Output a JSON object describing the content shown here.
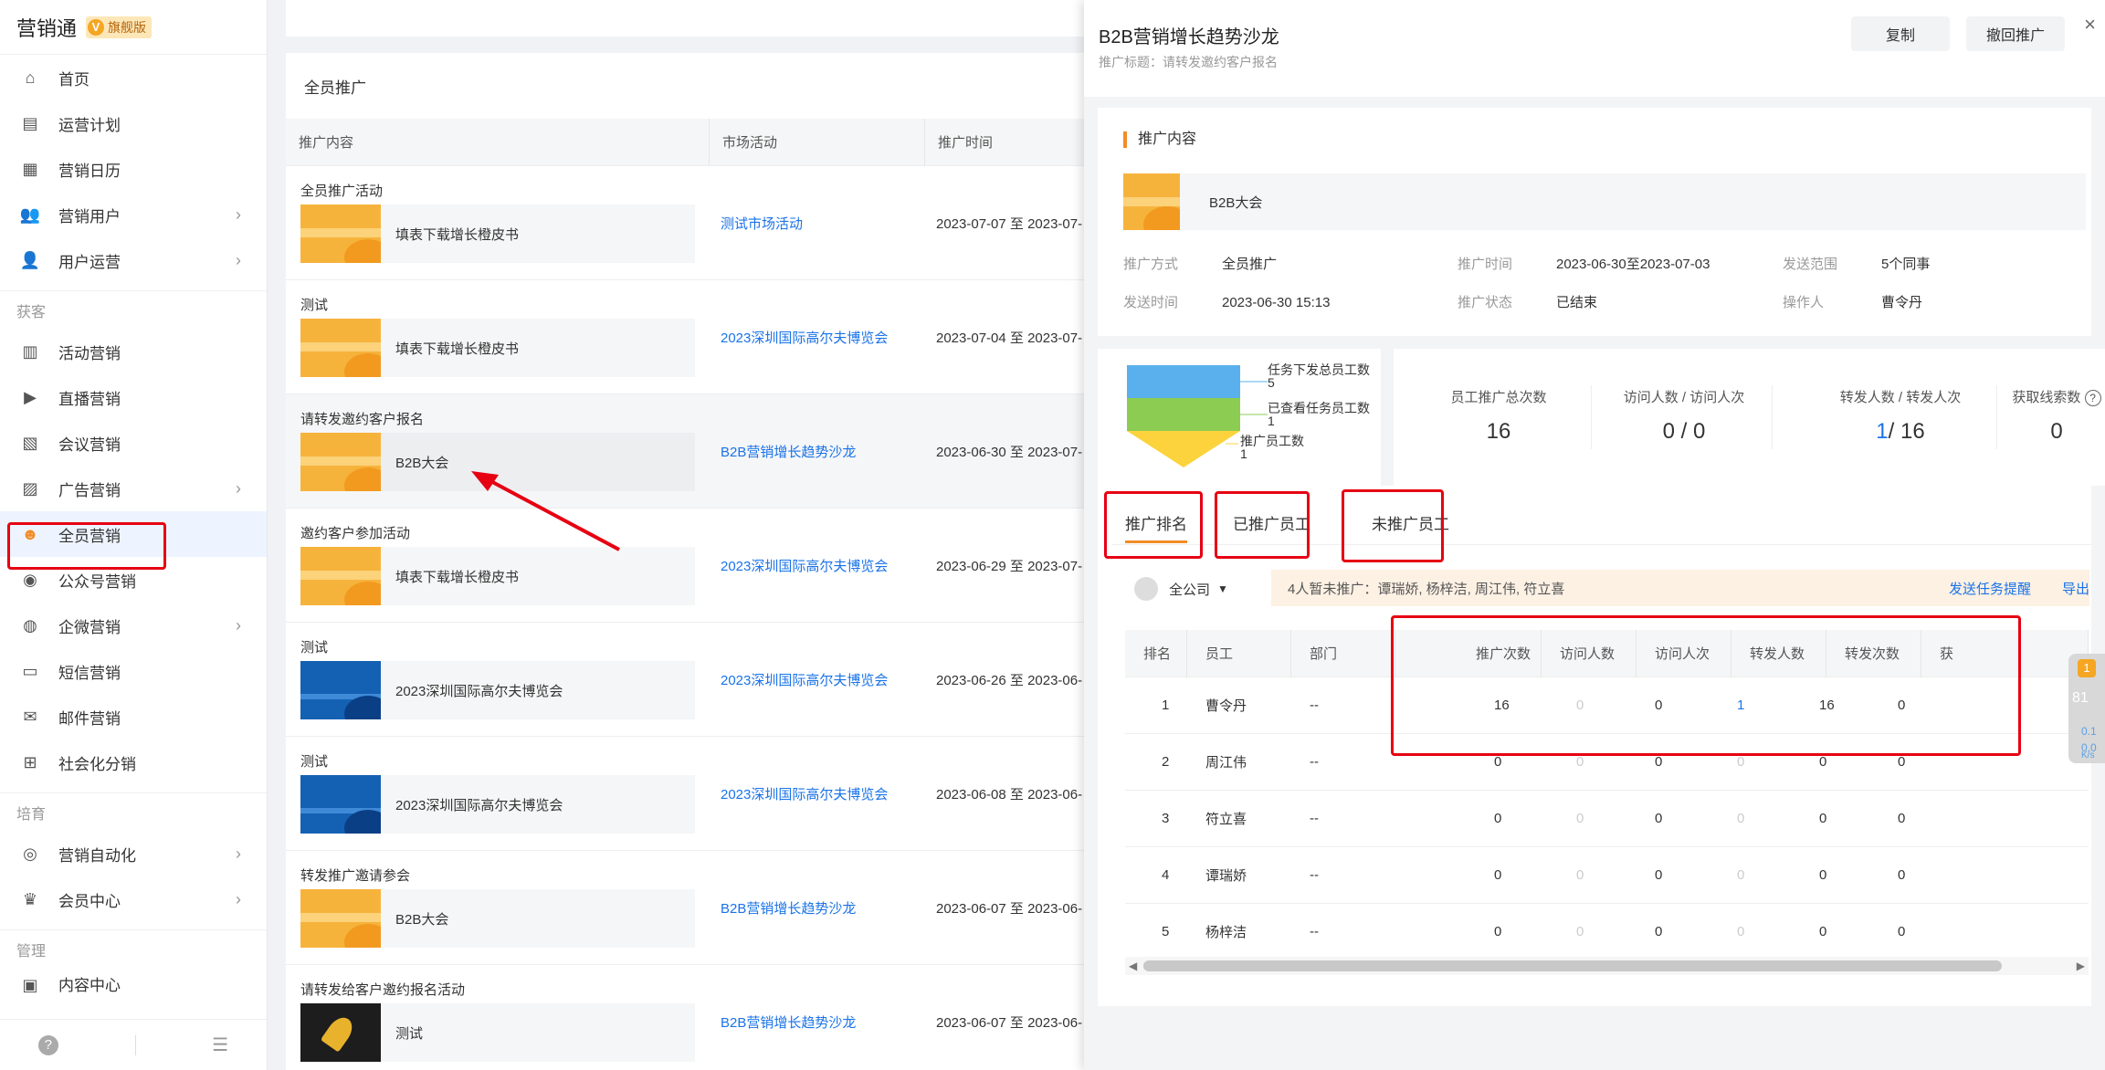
{
  "brand": {
    "name": "营销通",
    "badge": "旗舰版"
  },
  "sidebar": {
    "top_items": [
      {
        "label": "首页",
        "icon": "home-icon",
        "chev": false
      },
      {
        "label": "运营计划",
        "icon": "plan-icon",
        "chev": false
      },
      {
        "label": "营销日历",
        "icon": "calendar-icon",
        "chev": false
      },
      {
        "label": "营销用户",
        "icon": "users-icon",
        "chev": true
      },
      {
        "label": "用户运营",
        "icon": "user-ops-icon",
        "chev": true
      }
    ],
    "section_huoke": "获客",
    "huoke_items": [
      {
        "label": "活动营销",
        "icon": "activity-icon",
        "chev": false
      },
      {
        "label": "直播营销",
        "icon": "live-icon",
        "chev": false
      },
      {
        "label": "会议营销",
        "icon": "meeting-icon",
        "chev": false
      },
      {
        "label": "广告营销",
        "icon": "ad-icon",
        "chev": true
      },
      {
        "label": "全员营销",
        "icon": "team-icon",
        "chev": false
      },
      {
        "label": "公众号营销",
        "icon": "wechat-icon",
        "chev": false
      },
      {
        "label": "企微营销",
        "icon": "wecom-icon",
        "chev": true
      },
      {
        "label": "短信营销",
        "icon": "sms-icon",
        "chev": false
      },
      {
        "label": "邮件营销",
        "icon": "mail-icon",
        "chev": false
      },
      {
        "label": "社会化分销",
        "icon": "distribution-icon",
        "chev": false
      }
    ],
    "section_peiyu": "培育",
    "peiyu_items": [
      {
        "label": "营销自动化",
        "icon": "automation-icon",
        "chev": true
      },
      {
        "label": "会员中心",
        "icon": "member-icon",
        "chev": true
      }
    ],
    "section_guanli": "管理",
    "guanli_partial": "内容中心"
  },
  "list": {
    "title": "全员推广",
    "headers": [
      "推广内容",
      "市场活动",
      "推广时间"
    ],
    "rows": [
      {
        "title": "全员推广活动",
        "content": "填表下载增长橙皮书",
        "activity": "测试市场活动",
        "time": "2023-07-07 至 2023-07-",
        "thumb": "orange"
      },
      {
        "title": "测试",
        "content": "填表下载增长橙皮书",
        "activity": "2023深圳国际高尔夫博览会",
        "time": "2023-07-04 至 2023-07-",
        "thumb": "orange"
      },
      {
        "title": "请转发邀约客户报名",
        "content": "B2B大会",
        "activity": "B2B营销增长趋势沙龙",
        "time": "2023-06-30 至 2023-07-",
        "thumb": "orange"
      },
      {
        "title": "邀约客户参加活动",
        "content": "填表下载增长橙皮书",
        "activity": "2023深圳国际高尔夫博览会",
        "time": "2023-06-29 至 2023-07-",
        "thumb": "orange"
      },
      {
        "title": "测试",
        "content": "2023深圳国际高尔夫博览会",
        "activity": "2023深圳国际高尔夫博览会",
        "time": "2023-06-26 至 2023-06-",
        "thumb": "blue"
      },
      {
        "title": "测试",
        "content": "2023深圳国际高尔夫博览会",
        "activity": "2023深圳国际高尔夫博览会",
        "time": "2023-06-08 至 2023-06-",
        "thumb": "blue"
      },
      {
        "title": "转发推广邀请参会",
        "content": "B2B大会",
        "activity": "B2B营销增长趋势沙龙",
        "time": "2023-06-07 至 2023-06-",
        "thumb": "orange"
      },
      {
        "title": "请转发给客户邀约报名活动",
        "content": "测试",
        "activity": "B2B营销增长趋势沙龙",
        "time": "2023-06-07 至 2023-06-",
        "thumb": "dark"
      }
    ]
  },
  "drawer": {
    "title": "B2B营销增长趋势沙龙",
    "subtitle": "推广标题：请转发邀约客户报名",
    "btn_copy": "复制",
    "btn_revoke": "撤回推广",
    "close": "×",
    "section": "推广内容",
    "content_name": "B2B大会",
    "info": [
      {
        "k": "推广方式",
        "v": "全员推广"
      },
      {
        "k": "推广时间",
        "v": "2023-06-30至2023-07-03"
      },
      {
        "k": "发送范围",
        "v": "5个同事"
      },
      {
        "k": "发送时间",
        "v": "2023-06-30 15:13"
      },
      {
        "k": "推广状态",
        "v": "已结束"
      },
      {
        "k": "操作人",
        "v": "曹令丹"
      }
    ],
    "funnel": {
      "l1": "任务下发总员工数",
      "v1": "5",
      "l2": "已查看任务员工数",
      "v2": "1",
      "l3": "推广员工数",
      "v3": "1"
    },
    "stats": [
      {
        "label": "员工推广总次数",
        "value": "16"
      },
      {
        "label": "访问人数 / 访问人次",
        "value": "0 / 0"
      },
      {
        "label": "转发人数 / 转发人次",
        "v1": "1",
        "v2": "/ 16"
      },
      {
        "label": "获取线索数",
        "value": "0"
      }
    ],
    "tabs": [
      "推广排名",
      "已推广员工",
      "未推广员工"
    ],
    "company": "全公司",
    "notice": "4人暂未推广：谭瑞娇, 杨梓洁, 周江伟, 符立喜",
    "notice_link1": "发送任务提醒",
    "notice_link2": "导出",
    "table": {
      "headers": [
        "排名",
        "员工",
        "部门",
        "",
        "推广次数",
        "访问人数",
        "访问人次",
        "转发人数",
        "转发次数",
        "获"
      ],
      "rows": [
        [
          "1",
          "曹令丹",
          "--",
          "",
          "16",
          "0",
          "0",
          "1",
          "16",
          "0"
        ],
        [
          "2",
          "周江伟",
          "--",
          "",
          "0",
          "0",
          "0",
          "0",
          "0",
          "0"
        ],
        [
          "3",
          "符立喜",
          "--",
          "",
          "0",
          "0",
          "0",
          "0",
          "0",
          "0"
        ],
        [
          "4",
          "谭瑞娇",
          "--",
          "",
          "0",
          "0",
          "0",
          "0",
          "0",
          "0"
        ],
        [
          "5",
          "杨梓洁",
          "--",
          "",
          "0",
          "0",
          "0",
          "0",
          "0",
          "0"
        ]
      ]
    },
    "widget": {
      "badge": "1",
      "v1": "81",
      "v2": "0.1",
      "v3": "0.0",
      "unit": "K/s"
    }
  },
  "footer": {
    "help": "?",
    "collapse": "☰"
  }
}
